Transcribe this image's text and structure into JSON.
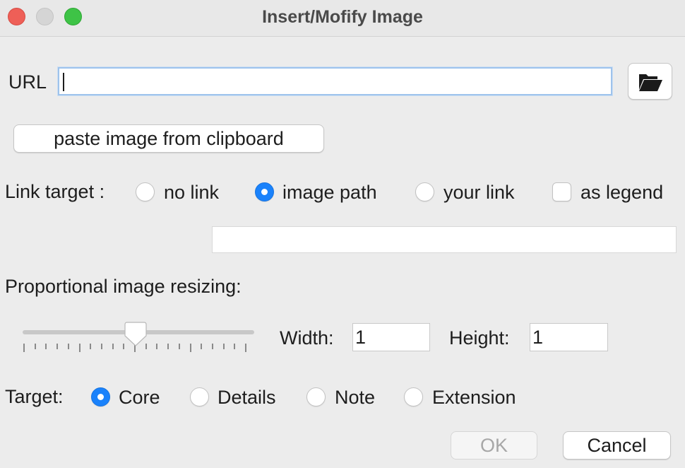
{
  "window": {
    "title": "Insert/Mofify Image",
    "controls": {
      "close_color": "#ee5f57",
      "minimize_color": "#d5d5d5",
      "maximize_color": "#3ec346"
    }
  },
  "url": {
    "label": "URL",
    "value": "",
    "browse_icon": "folder-open-icon"
  },
  "paste_button": "paste image from clipboard",
  "link_target": {
    "label": "Link target :",
    "options": [
      {
        "label": "no link",
        "selected": false
      },
      {
        "label": "image path",
        "selected": true
      },
      {
        "label": "your link",
        "selected": false
      }
    ],
    "as_legend": {
      "label": "as legend",
      "checked": false
    },
    "link_value": ""
  },
  "resizing": {
    "label": "Proportional image resizing:",
    "slider_level": 0.5,
    "width_label": "Width:",
    "width_value": "1",
    "height_label": "Height:",
    "height_value": "1"
  },
  "target": {
    "label": "Target:",
    "options": [
      {
        "label": "Core",
        "selected": true
      },
      {
        "label": "Details",
        "selected": false
      },
      {
        "label": "Note",
        "selected": false
      },
      {
        "label": "Extension",
        "selected": false
      }
    ]
  },
  "buttons": {
    "ok": "OK",
    "ok_enabled": false,
    "cancel": "Cancel"
  },
  "colors": {
    "accent": "#1a82fb",
    "focus_ring": "#9ec3ec",
    "background": "#ececec"
  }
}
